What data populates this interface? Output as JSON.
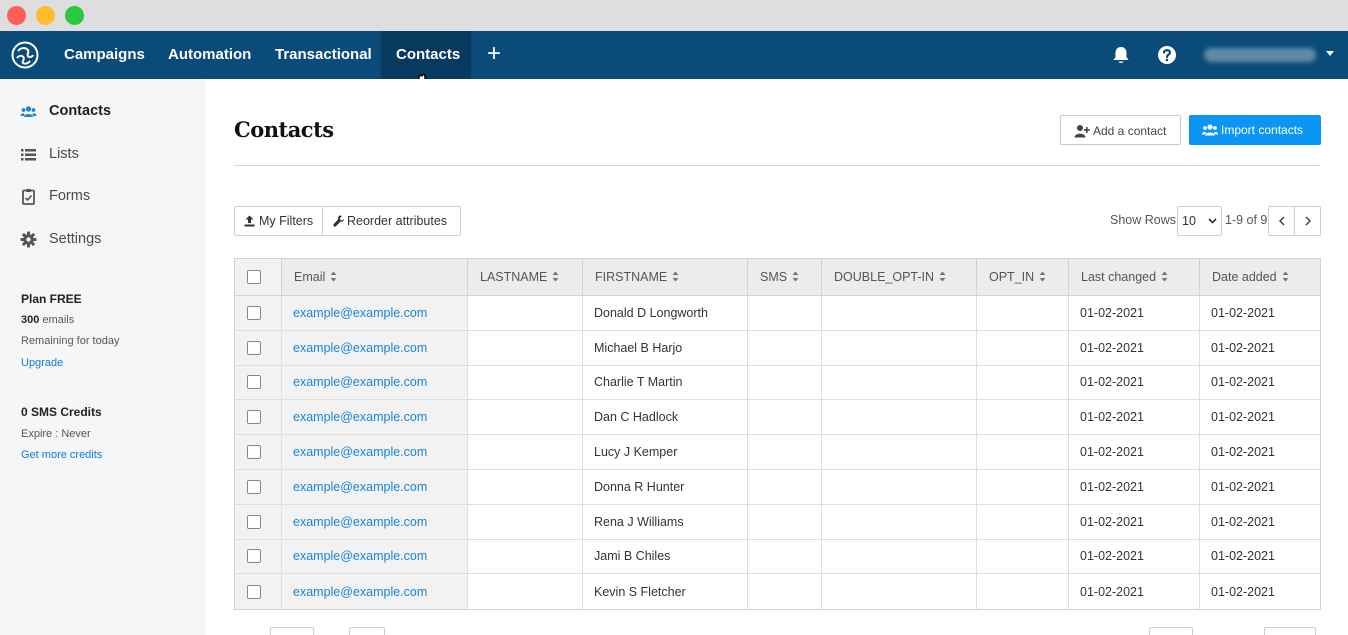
{
  "nav": {
    "items": [
      {
        "label": "Campaigns",
        "active": false
      },
      {
        "label": "Automation",
        "active": false
      },
      {
        "label": "Transactional",
        "active": false
      },
      {
        "label": "Contacts",
        "active": true
      }
    ],
    "plus": "+",
    "icons": [
      "logo-icon",
      "bell-icon",
      "help-icon",
      "caret-down-icon"
    ]
  },
  "sidebar": {
    "items": [
      {
        "label": "Contacts",
        "icon": "users-icon",
        "active": true
      },
      {
        "label": "Lists",
        "icon": "list-icon",
        "active": false
      },
      {
        "label": "Forms",
        "icon": "clipboard-icon",
        "active": false
      },
      {
        "label": "Settings",
        "icon": "gear-icon",
        "active": false
      }
    ],
    "plan": {
      "title": "Plan FREE",
      "emails_count": "300",
      "emails_label": " emails",
      "remaining": "Remaining for today",
      "upgrade": "Upgrade"
    },
    "sms": {
      "title": "0 SMS Credits",
      "expire": "Expire : Never",
      "link": "Get more credits"
    }
  },
  "main": {
    "title": "Contacts",
    "add_contact": "Add a contact",
    "import_contacts": "Import contacts",
    "my_filters": "My Filters",
    "reorder_attributes": "Reorder attributes",
    "show_rows_label": "Show Rows:",
    "show_rows_value": "10",
    "page_range": "1-9 of 9"
  },
  "table": {
    "columns": [
      "Email",
      "LASTNAME",
      "FIRSTNAME",
      "SMS",
      "DOUBLE_OPT-IN",
      "OPT_IN",
      "Last changed",
      "Date added"
    ],
    "rows": [
      {
        "email": "example@example.com",
        "lastname": "",
        "firstname": "Donald D Longworth",
        "sms": "",
        "double_opt_in": "",
        "opt_in": "",
        "last_changed": "01-02-2021",
        "date_added": "01-02-2021"
      },
      {
        "email": "example@example.com",
        "lastname": "",
        "firstname": "Michael B Harjo",
        "sms": "",
        "double_opt_in": "",
        "opt_in": "",
        "last_changed": "01-02-2021",
        "date_added": "01-02-2021"
      },
      {
        "email": "example@example.com",
        "lastname": "",
        "firstname": "Charlie T Martin",
        "sms": "",
        "double_opt_in": "",
        "opt_in": "",
        "last_changed": "01-02-2021",
        "date_added": "01-02-2021"
      },
      {
        "email": "example@example.com",
        "lastname": "",
        "firstname": "Dan C Hadlock",
        "sms": "",
        "double_opt_in": "",
        "opt_in": "",
        "last_changed": "01-02-2021",
        "date_added": "01-02-2021"
      },
      {
        "email": "example@example.com",
        "lastname": "",
        "firstname": "Lucy J Kemper",
        "sms": "",
        "double_opt_in": "",
        "opt_in": "",
        "last_changed": "01-02-2021",
        "date_added": "01-02-2021"
      },
      {
        "email": "example@example.com",
        "lastname": "",
        "firstname": "Donna R Hunter",
        "sms": "",
        "double_opt_in": "",
        "opt_in": "",
        "last_changed": "01-02-2021",
        "date_added": "01-02-2021"
      },
      {
        "email": "example@example.com",
        "lastname": "",
        "firstname": "Rena J Williams",
        "sms": "",
        "double_opt_in": "",
        "opt_in": "",
        "last_changed": "01-02-2021",
        "date_added": "01-02-2021"
      },
      {
        "email": "example@example.com",
        "lastname": "",
        "firstname": "Jami B Chiles",
        "sms": "",
        "double_opt_in": "",
        "opt_in": "",
        "last_changed": "01-02-2021",
        "date_added": "01-02-2021"
      },
      {
        "email": "example@example.com",
        "lastname": "",
        "firstname": "Kevin S Fletcher",
        "sms": "",
        "double_opt_in": "",
        "opt_in": "",
        "last_changed": "01-02-2021",
        "date_added": "01-02-2021"
      }
    ]
  },
  "colors": {
    "nav_bg": "#0b4b79",
    "nav_active": "#08395f",
    "primary_button": "#0b96f5",
    "link": "#1a84d8"
  }
}
